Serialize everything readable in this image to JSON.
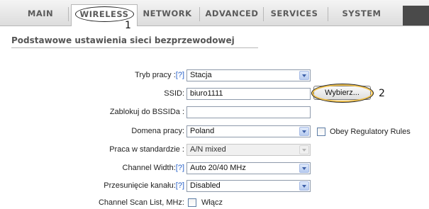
{
  "tabs": [
    {
      "label": "MAIN"
    },
    {
      "label": "WIRELESS"
    },
    {
      "label": "NETWORK"
    },
    {
      "label": "ADVANCED"
    },
    {
      "label": "SERVICES"
    },
    {
      "label": "SYSTEM"
    }
  ],
  "annotations": {
    "callout_1": "1",
    "callout_2": "2"
  },
  "section": {
    "title": "Podstawowe ustawienia sieci bezprzewodowej"
  },
  "help_marker": "[?]",
  "form": {
    "mode": {
      "label": "Tryb pracy :",
      "value": "Stacja"
    },
    "ssid": {
      "label": "SSID:",
      "value": "biuro1111",
      "button_label": "Wybierz..."
    },
    "bssid_lock": {
      "label": "Zablokuj do BSSIDa :",
      "value": ""
    },
    "domain": {
      "label": "Domena pracy:",
      "value": "Poland",
      "checkbox_label": "Obey Regulatory Rules"
    },
    "standard": {
      "label": "Praca w standardzie :",
      "value": "A/N mixed"
    },
    "channel_width": {
      "label": "Channel Width:",
      "value": "Auto 20/40 MHz"
    },
    "channel_shift": {
      "label": "Przesunięcie kanału:",
      "value": "Disabled"
    },
    "scan_list": {
      "label": "Channel Scan List, MHz:",
      "checkbox_label": "Włącz"
    }
  },
  "colors": {
    "help_link": "#2a63c9",
    "callout_highlight": "#f3c24a"
  }
}
